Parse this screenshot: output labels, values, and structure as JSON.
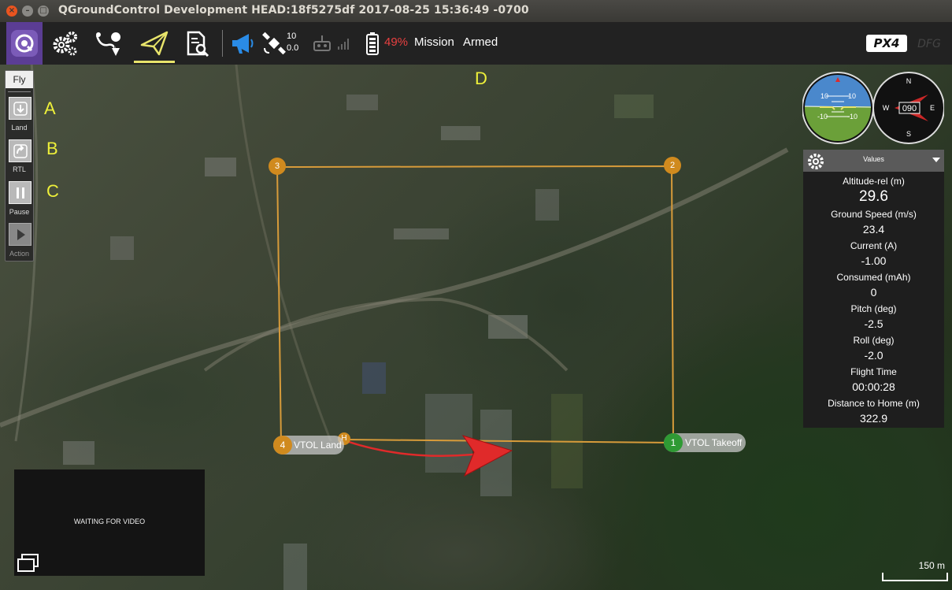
{
  "window": {
    "title": "QGroundControl Development HEAD:18f5275df 2017-08-25 15:36:49 -0700",
    "close_glyph": "×",
    "min_glyph": "–",
    "max_glyph": "□"
  },
  "toolbar": {
    "icons": [
      "qgc-logo-icon",
      "settings-gears-icon",
      "plan-icon",
      "fly-icon",
      "analyze-icon",
      "messages-megaphone-icon",
      "gps-satellite-icon",
      "rc-transmitter-icon",
      "rssi-bars-icon",
      "battery-icon"
    ],
    "gps_count": "10",
    "gps_hdop": "0.0",
    "battery_percent": "49%",
    "flight_mode": "Mission",
    "arm_state": "Armed",
    "brand": "PX4 autopilot",
    "brand_suffix": "DFG",
    "colors": {
      "active_underline": "#e8e46b",
      "battery_low": "#e84040",
      "messages": "#2a8be6"
    }
  },
  "fly_panel": {
    "title": "Fly",
    "buttons": [
      {
        "label": "Land",
        "icon": "land-icon"
      },
      {
        "label": "RTL",
        "icon": "rtl-icon"
      },
      {
        "label": "Pause",
        "icon": "pause-icon"
      },
      {
        "label": "Action",
        "icon": "play-icon"
      }
    ]
  },
  "annotations": [
    "A",
    "B",
    "C",
    "D"
  ],
  "instruments": {
    "attitude_ticks": [
      "10",
      "10",
      "-10",
      "-10"
    ],
    "compass_heading": "090",
    "compass_labels": [
      "N",
      "E",
      "S",
      "W"
    ]
  },
  "values_panel": {
    "title": "Values",
    "items": [
      {
        "label": "Altitude-rel (m)",
        "value": "29.6"
      },
      {
        "label": "Ground Speed (m/s)",
        "value": "23.4"
      },
      {
        "label": "Current (A)",
        "value": "-1.00"
      },
      {
        "label": "Consumed (mAh)",
        "value": "0"
      },
      {
        "label": "Pitch (deg)",
        "value": "-2.5"
      },
      {
        "label": "Roll (deg)",
        "value": "-2.0"
      },
      {
        "label": "Flight Time",
        "value": "00:00:28"
      },
      {
        "label": "Distance to Home (m)",
        "value": "322.9"
      }
    ]
  },
  "mission": {
    "waypoints": [
      {
        "num": "1",
        "label": "VTOL Takeoff"
      },
      {
        "num": "2"
      },
      {
        "num": "3"
      },
      {
        "num": "4",
        "label": "VTOL Land"
      }
    ],
    "home": "H",
    "colors": {
      "path": "#d79b3a",
      "waypoint": "#d08a1e",
      "takeoff": "#2f9a34",
      "vehicle": "#e02a2a"
    }
  },
  "video": {
    "status": "WAITING FOR VIDEO"
  },
  "map": {
    "scale_label": "150 m"
  }
}
